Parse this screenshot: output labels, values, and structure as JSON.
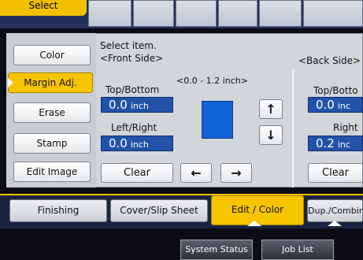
{
  "top": {
    "select_label": "Select"
  },
  "side_buttons": [
    "Color",
    "Margin Adj.",
    "Erase",
    "Stamp",
    "Edit Image"
  ],
  "instruction": "Select item.",
  "front": {
    "heading": "<Front Side>",
    "range": "<0.0 - 1.2 inch>",
    "top_bottom_label": "Top/Bottom",
    "top_bottom_value": "0.0",
    "left_right_label": "Left/Right",
    "left_right_value": "0.0",
    "unit": "inch"
  },
  "back": {
    "heading": "<Back Side>",
    "top_bottom_label": "Top/Botto",
    "top_bottom_value": "0.0",
    "top_bottom_unit": "inc",
    "right_label": "Right",
    "right_value": "0.2",
    "right_unit": "inc"
  },
  "buttons": {
    "clear": "Clear",
    "clear_back": "Clear",
    "up": "↑",
    "down": "↓",
    "left": "←",
    "right": "→"
  },
  "tabs": [
    "Finishing",
    "Cover/Slip Sheet",
    "Edit / Color",
    "Dup./Combin"
  ],
  "status": {
    "system_status": "System Status",
    "job_list": "Job List"
  },
  "colors": {
    "accent": "#f7c400",
    "value_box": "#2352a8",
    "preview": "#1463d6",
    "panel": "#d3d6d9"
  }
}
